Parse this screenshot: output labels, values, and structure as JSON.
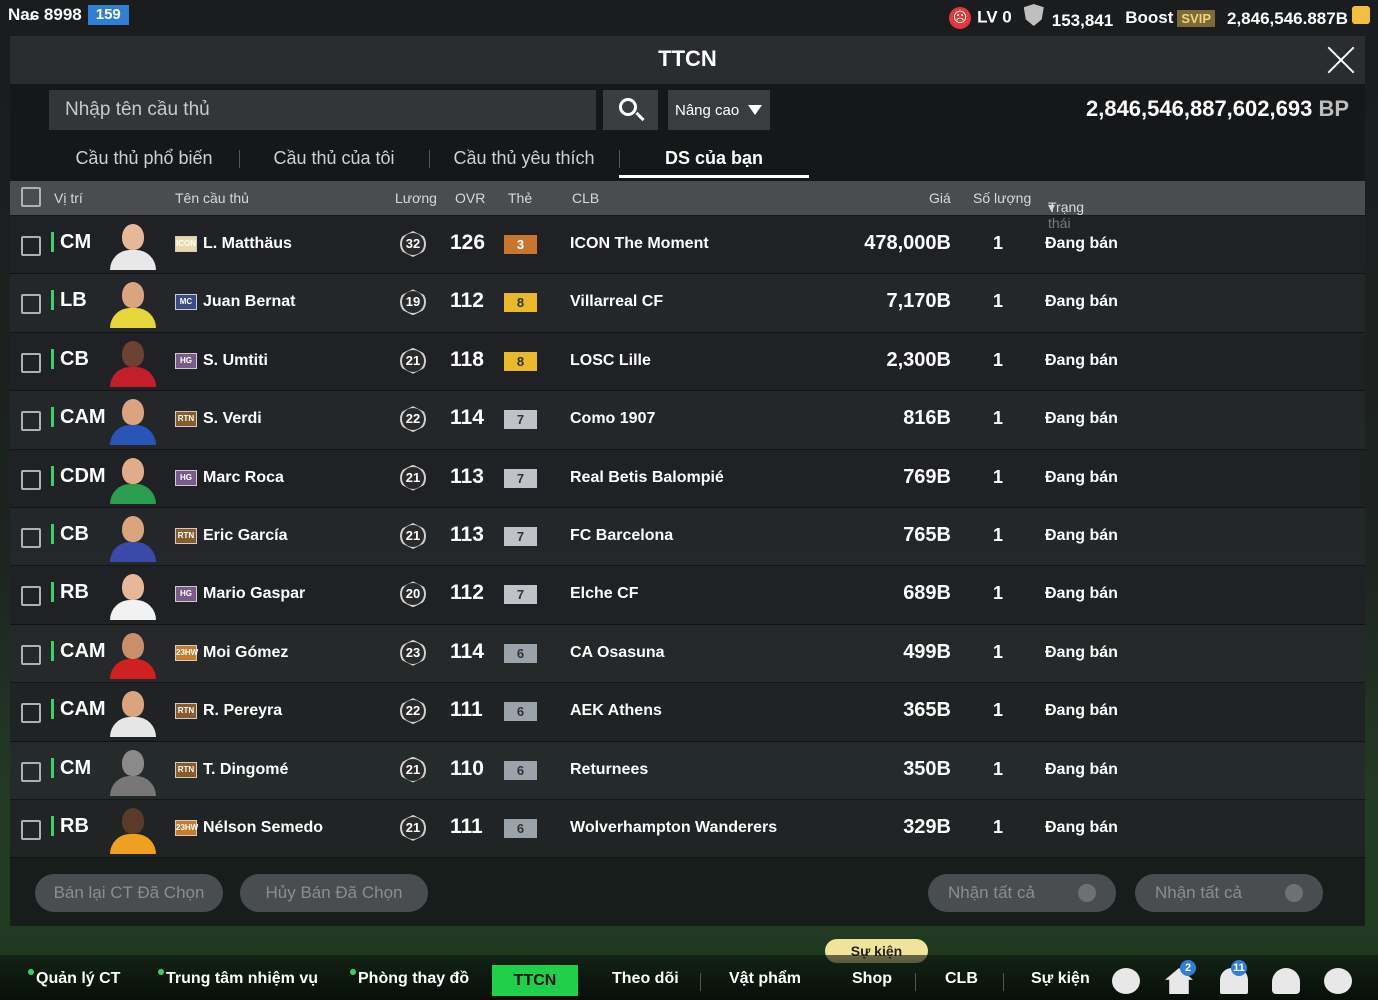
{
  "account": {
    "name": "Naɕ 8998",
    "level": "159"
  },
  "status_bar": {
    "lv": "LV 0",
    "points": "153,841",
    "boost": "Boost",
    "svip": "SVIP",
    "bp": "2,846,546.887B"
  },
  "panel": {
    "title": "TTCN"
  },
  "search": {
    "placeholder": "Nhập tên cầu thủ",
    "advanced_label": "Nâng cao",
    "bp_value": "2,846,546,887,602,693",
    "bp_unit": "BP"
  },
  "tabs": [
    {
      "label": "Cầu thủ phổ biến"
    },
    {
      "label": "Cầu thủ của tôi"
    },
    {
      "label": "Cầu thủ yêu thích"
    },
    {
      "label": "DS của bạn"
    }
  ],
  "columns": {
    "position": "Vị trí",
    "name": "Tên cầu thủ",
    "salary": "Lương",
    "ovr": "OVR",
    "card": "Thẻ",
    "club": "CLB",
    "price": "Giá",
    "qty": "Số lượng",
    "status": "Trạng thái"
  },
  "players": [
    {
      "pos": "CM",
      "season": "ICON",
      "name": "L. Matthäus",
      "salary": "32",
      "ovr": "126",
      "grade": "3",
      "grade_color": "#c7762f",
      "club": "ICON The Moment",
      "price": "478,000B",
      "qty": "1",
      "status": "Đang bán"
    },
    {
      "pos": "LB",
      "season": "MC",
      "name": "Juan Bernat",
      "salary": "19",
      "ovr": "112",
      "grade": "8",
      "grade_color": "#e8b92a",
      "club": "Villarreal CF",
      "price": "7,170B",
      "qty": "1",
      "status": "Đang bán"
    },
    {
      "pos": "CB",
      "season": "HG",
      "name": "S. Umtiti",
      "salary": "21",
      "ovr": "118",
      "grade": "8",
      "grade_color": "#e8b92a",
      "club": "LOSC Lille",
      "price": "2,300B",
      "qty": "1",
      "status": "Đang bán"
    },
    {
      "pos": "CAM",
      "season": "RTN",
      "name": "S. Verdi",
      "salary": "22",
      "ovr": "114",
      "grade": "7",
      "grade_color": "#bfc3c7",
      "club": "Como 1907",
      "price": "816B",
      "qty": "1",
      "status": "Đang bán"
    },
    {
      "pos": "CDM",
      "season": "HG",
      "name": "Marc Roca",
      "salary": "21",
      "ovr": "113",
      "grade": "7",
      "grade_color": "#bfc3c7",
      "club": "Real Betis Balompié",
      "price": "769B",
      "qty": "1",
      "status": "Đang bán"
    },
    {
      "pos": "CB",
      "season": "RTN",
      "name": "Eric García",
      "salary": "21",
      "ovr": "113",
      "grade": "7",
      "grade_color": "#bfc3c7",
      "club": "FC Barcelona",
      "price": "765B",
      "qty": "1",
      "status": "Đang bán"
    },
    {
      "pos": "RB",
      "season": "HG",
      "name": "Mario Gaspar",
      "salary": "20",
      "ovr": "112",
      "grade": "7",
      "grade_color": "#bfc3c7",
      "club": "Elche CF",
      "price": "689B",
      "qty": "1",
      "status": "Đang bán"
    },
    {
      "pos": "CAM",
      "season": "23HW",
      "name": "Moi Gómez",
      "salary": "23",
      "ovr": "114",
      "grade": "6",
      "grade_color": "#9aa2aa",
      "club": "CA Osasuna",
      "price": "499B",
      "qty": "1",
      "status": "Đang bán"
    },
    {
      "pos": "CAM",
      "season": "RTN",
      "name": "R. Pereyra",
      "salary": "22",
      "ovr": "111",
      "grade": "6",
      "grade_color": "#9aa2aa",
      "club": "AEK Athens",
      "price": "365B",
      "qty": "1",
      "status": "Đang bán"
    },
    {
      "pos": "CM",
      "season": "RTN",
      "name": "T. Dingomé",
      "salary": "21",
      "ovr": "110",
      "grade": "6",
      "grade_color": "#9aa2aa",
      "club": "Returnees",
      "price": "350B",
      "qty": "1",
      "status": "Đang bán"
    },
    {
      "pos": "RB",
      "season": "23HW",
      "name": "Nélson Semedo",
      "salary": "21",
      "ovr": "111",
      "grade": "6",
      "grade_color": "#9aa2aa",
      "club": "Wolverhampton Wanderers",
      "price": "329B",
      "qty": "1",
      "status": "Đang bán"
    }
  ],
  "actions": {
    "resell": "Bán lại CT Đã Chọn",
    "cancel": "Hủy Bán Đã Chọn",
    "claim_all_1": "Nhận tất cả",
    "claim_all_2": "Nhận tất cả"
  },
  "bottom_nav": {
    "manage": "Quản lý CT",
    "missions": "Trung tâm nhiệm vụ",
    "locker": "Phòng thay đồ",
    "ttcn": "TTCN",
    "follow": "Theo dõi",
    "items": "Vật phẩm",
    "shop": "Shop",
    "event_pill": "Sự kiện",
    "club": "CLB",
    "events": "Sự kiện",
    "badge_home": "2",
    "badge_bell": "11"
  }
}
